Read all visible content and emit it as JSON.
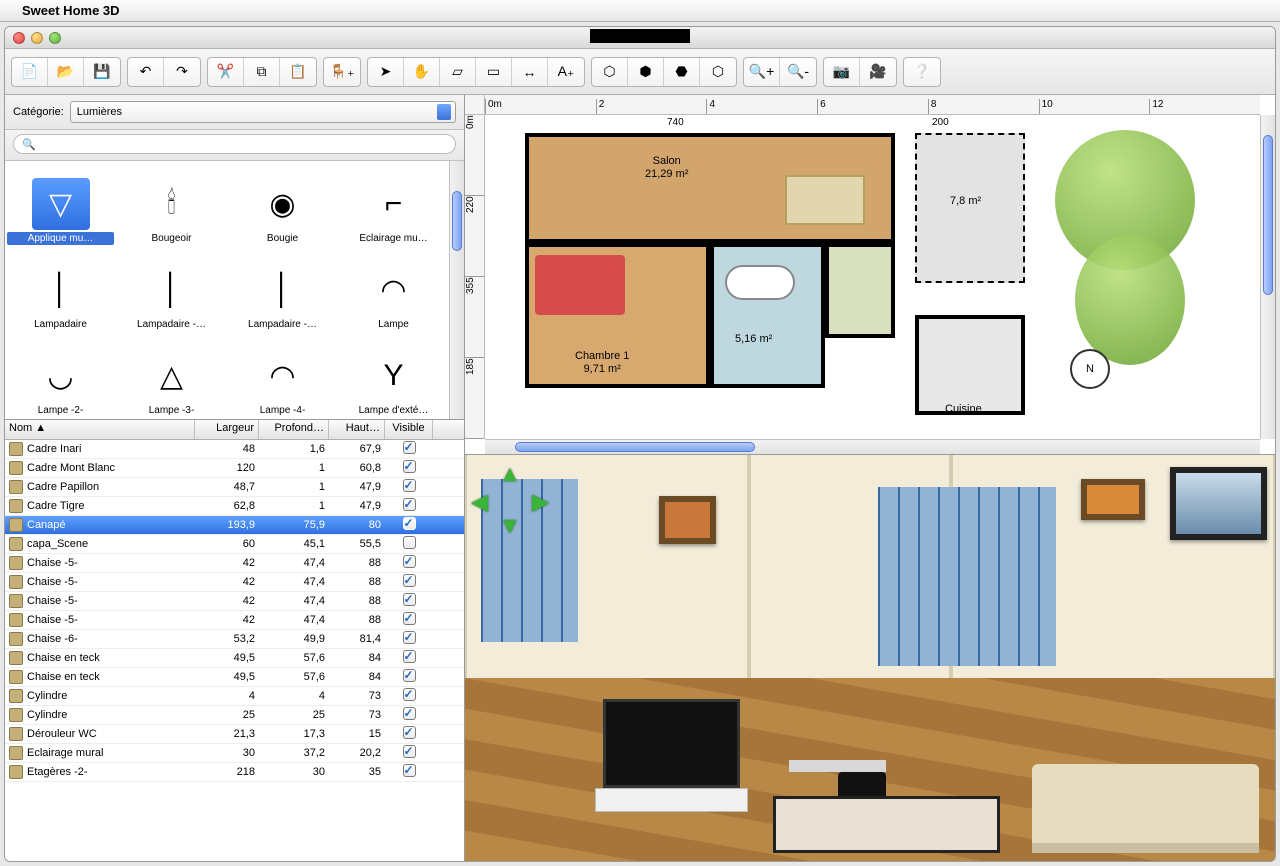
{
  "menubar": {
    "app_title": "Sweet Home 3D"
  },
  "toolbar_groups": [
    [
      "new",
      "open",
      "save"
    ],
    [
      "undo",
      "redo"
    ],
    [
      "cut",
      "copy",
      "paste"
    ],
    [
      "add-furniture"
    ],
    [
      "select",
      "pan",
      "create-walls",
      "create-rooms",
      "create-dimensions",
      "create-text"
    ],
    [
      "3d-view-top",
      "3d-view-virtual",
      "3d-modify",
      "3d-export"
    ],
    [
      "zoom-in",
      "zoom-out"
    ],
    [
      "photo",
      "video"
    ],
    [
      "help"
    ]
  ],
  "catalog": {
    "category_label": "Catégorie:",
    "category_value": "Lumières",
    "search_icon_label": "🔍",
    "items": [
      {
        "label": "Applique mu…",
        "selected": true,
        "glyph": "▽"
      },
      {
        "label": "Bougeoir",
        "glyph": "🕯"
      },
      {
        "label": "Bougie",
        "glyph": "◉"
      },
      {
        "label": "Eclairage mu…",
        "glyph": "⌐"
      },
      {
        "label": "Lampadaire",
        "glyph": "│"
      },
      {
        "label": "Lampadaire -…",
        "glyph": "│"
      },
      {
        "label": "Lampadaire -…",
        "glyph": "│"
      },
      {
        "label": "Lampe",
        "glyph": "◠"
      },
      {
        "label": "Lampe -2-",
        "glyph": "◡"
      },
      {
        "label": "Lampe -3-",
        "glyph": "△"
      },
      {
        "label": "Lampe -4-",
        "glyph": "◠"
      },
      {
        "label": "Lampe d'exté…",
        "glyph": "Y"
      }
    ]
  },
  "furniture_table": {
    "columns": {
      "name": "Nom ▲",
      "width": "Largeur",
      "depth": "Profond…",
      "height": "Haut…",
      "visible": "Visible"
    },
    "rows": [
      {
        "name": "Cadre Inari",
        "w": "48",
        "d": "1,6",
        "h": "67,9",
        "v": true
      },
      {
        "name": "Cadre Mont Blanc",
        "w": "120",
        "d": "1",
        "h": "60,8",
        "v": true
      },
      {
        "name": "Cadre Papillon",
        "w": "48,7",
        "d": "1",
        "h": "47,9",
        "v": true
      },
      {
        "name": "Cadre Tigre",
        "w": "62,8",
        "d": "1",
        "h": "47,9",
        "v": true
      },
      {
        "name": "Canapé",
        "w": "193,9",
        "d": "75,9",
        "h": "80",
        "v": true,
        "selected": true
      },
      {
        "name": "capa_Scene",
        "w": "60",
        "d": "45,1",
        "h": "55,5",
        "v": false
      },
      {
        "name": "Chaise -5-",
        "w": "42",
        "d": "47,4",
        "h": "88",
        "v": true
      },
      {
        "name": "Chaise -5-",
        "w": "42",
        "d": "47,4",
        "h": "88",
        "v": true
      },
      {
        "name": "Chaise -5-",
        "w": "42",
        "d": "47,4",
        "h": "88",
        "v": true
      },
      {
        "name": "Chaise -5-",
        "w": "42",
        "d": "47,4",
        "h": "88",
        "v": true
      },
      {
        "name": "Chaise -6-",
        "w": "53,2",
        "d": "49,9",
        "h": "81,4",
        "v": true
      },
      {
        "name": "Chaise en teck",
        "w": "49,5",
        "d": "57,6",
        "h": "84",
        "v": true
      },
      {
        "name": "Chaise en teck",
        "w": "49,5",
        "d": "57,6",
        "h": "84",
        "v": true
      },
      {
        "name": "Cylindre",
        "w": "4",
        "d": "4",
        "h": "73",
        "v": true
      },
      {
        "name": "Cylindre",
        "w": "25",
        "d": "25",
        "h": "73",
        "v": true
      },
      {
        "name": "Dérouleur WC",
        "w": "21,3",
        "d": "17,3",
        "h": "15",
        "v": true
      },
      {
        "name": "Eclairage mural",
        "w": "30",
        "d": "37,2",
        "h": "20,2",
        "v": true
      },
      {
        "name": "Etagères -2-",
        "w": "218",
        "d": "30",
        "h": "35",
        "v": true
      }
    ]
  },
  "plan": {
    "h_ticks": [
      "0m",
      "2",
      "4",
      "6",
      "8",
      "10",
      "12"
    ],
    "v_ticks": [
      "0m",
      "220",
      "355",
      "185"
    ],
    "dims": {
      "top1": "740",
      "top2": "200"
    },
    "rooms": [
      {
        "name": "Salon",
        "area": "21,29 m²"
      },
      {
        "name": "Chambre 1",
        "area": "9,71 m²"
      },
      {
        "name": "",
        "area": "5,16 m²"
      },
      {
        "name": "",
        "area": "7,8 m²"
      },
      {
        "name": "Cuisine",
        "area": ""
      }
    ],
    "compass_label": "N"
  }
}
